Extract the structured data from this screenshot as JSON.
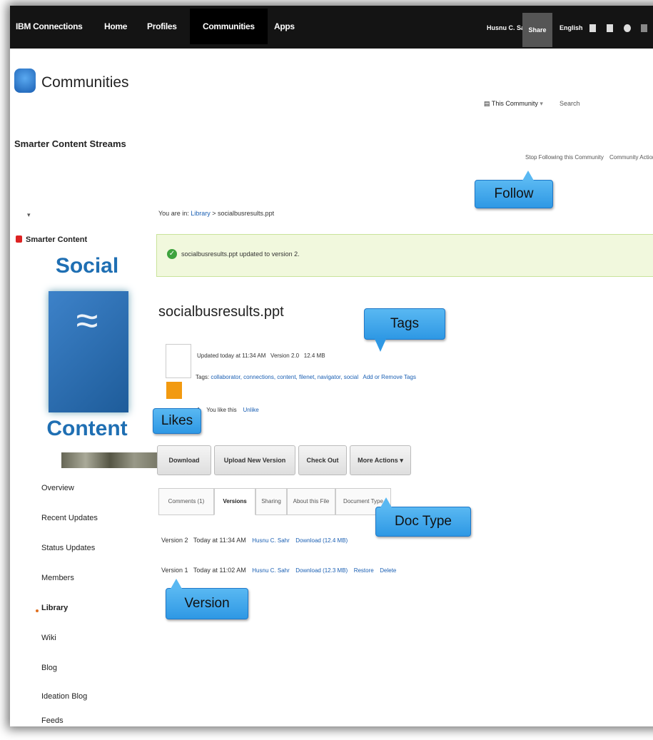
{
  "topbar": {
    "brand": "IBM Connections",
    "nav": [
      "Home",
      "Profiles",
      "Communities",
      "Apps"
    ],
    "user": "Husnu C. Sahr",
    "share": "Share",
    "language": "English"
  },
  "header": {
    "title": "Communities",
    "community_name": "Smarter Content Streams",
    "scope": "This Community",
    "search_placeholder": "Search",
    "stop_following": "Stop Following this Community",
    "community_actions": "Community Actions"
  },
  "sidebar": {
    "toggle": "▾",
    "community": "Smarter Content",
    "image_words": [
      "Social",
      "Content"
    ],
    "items": [
      "Overview",
      "Recent Updates",
      "Status Updates",
      "Members",
      "Library",
      "Wiki",
      "Blog",
      "Ideation Blog",
      "Feeds"
    ],
    "active_item": "Library"
  },
  "breadcrumb": {
    "prefix": "You are in:",
    "library": "Library",
    "separator": ">",
    "file": "socialbusresults.ppt"
  },
  "banner": {
    "message": "socialbusresults.ppt updated to version 2.",
    "close": "×"
  },
  "file": {
    "title": "socialbusresults.ppt",
    "updated": "Updated today at 11:34 AM",
    "version": "Version 2.0",
    "size": "12.4 MB",
    "tags_label": "Tags:",
    "tags": "collaborator, connections, content, filenet, navigator, social",
    "add_tags": "Add or Remove Tags",
    "likes_count": "1",
    "likes_text": "You like this",
    "unlike": "Unlike"
  },
  "actions": [
    "Download",
    "Upload New Version",
    "Check Out",
    "More Actions ▾"
  ],
  "tabs": [
    "Comments (1)",
    "Versions",
    "Sharing",
    "About this File",
    "Document Type"
  ],
  "active_tab": "Versions",
  "versions": [
    {
      "version": "Version 2",
      "time": "Today at 11:34 AM",
      "author": "Husnu C. Sahr",
      "download": "Download (12.4 MB)",
      "restore": "",
      "delete": ""
    },
    {
      "version": "Version 1",
      "time": "Today at 11:02 AM",
      "author": "Husnu C. Sahr",
      "download": "Download (12.3 MB)",
      "restore": "Restore",
      "delete": "Delete"
    }
  ],
  "callouts": {
    "follow": "Follow",
    "tags": "Tags",
    "likes": "Likes",
    "doc_type": "Doc Type",
    "version": "Version"
  },
  "colors": {
    "topbar": "#141414",
    "link": "#1a5fb3",
    "callout": "#3ea6ee",
    "banner": "#f1f8dd"
  }
}
